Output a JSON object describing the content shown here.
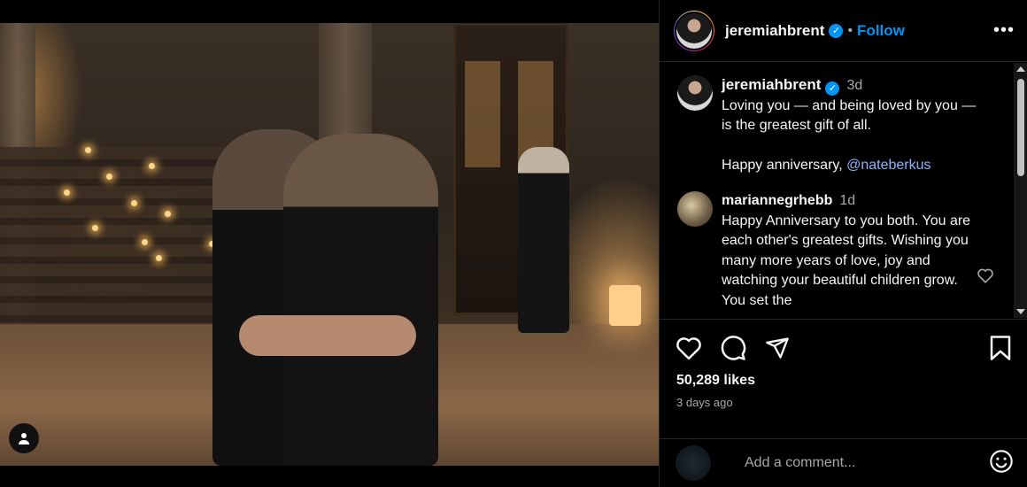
{
  "post": {
    "username": "jeremiahbrent",
    "verified_icon": "verified-badge-icon",
    "follow_label": "Follow",
    "more_label": "•••"
  },
  "comments": [
    {
      "username": "jeremiahbrent",
      "time": "3d",
      "text_line1": "Loving you — and being loved by you — is the greatest gift of all.",
      "text_line2_prefix": "Happy anniversary, ",
      "mention": "@nateberkus"
    },
    {
      "username": "mariannegrhebb",
      "time": "1d",
      "text": "Happy Anniversary to you both. You are each other's greatest gifts. Wishing you many more years of love, joy and watching your beautiful children grow. You set the"
    }
  ],
  "stats": {
    "likes": "50,289 likes",
    "posted": "3 days ago"
  },
  "composer": {
    "placeholder": "Add a comment..."
  },
  "colors": {
    "accent": "#0095f6",
    "background": "#000000",
    "secondary_text": "#a8a8a8"
  }
}
